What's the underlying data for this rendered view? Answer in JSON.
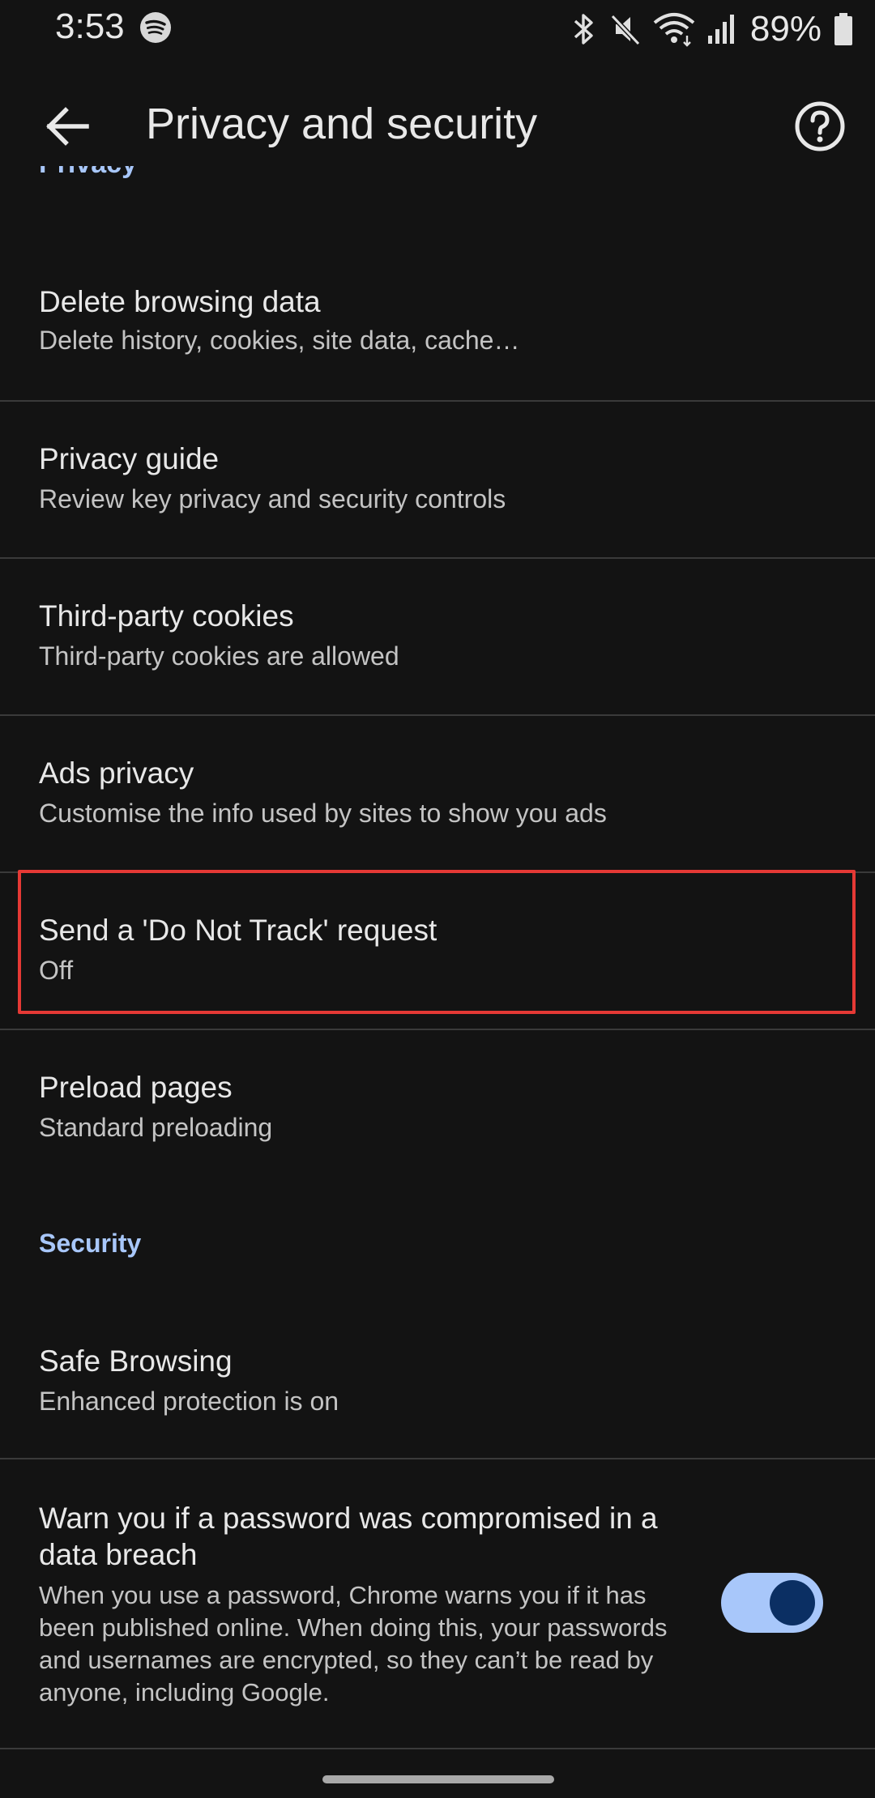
{
  "status_bar": {
    "time": "3:53",
    "battery": "89%",
    "icons": [
      "spotify-icon",
      "bluetooth-icon",
      "mute-icon",
      "wifi-icon",
      "signal-icon",
      "battery-icon"
    ]
  },
  "app_bar": {
    "title": "Privacy and security",
    "icons": [
      "back-arrow-icon",
      "help-icon"
    ]
  },
  "sections": {
    "privacy_header": "Privacy",
    "security_header": "Security"
  },
  "items": [
    {
      "title": "Delete browsing data",
      "subtitle": "Delete history, cookies, site data, cache…"
    },
    {
      "title": "Privacy guide",
      "subtitle": "Review key privacy and security controls"
    },
    {
      "title": "Third-party cookies",
      "subtitle": "Third-party cookies are allowed"
    },
    {
      "title": "Ads privacy",
      "subtitle": "Customise the info used by sites to show you ads"
    },
    {
      "title": "Send a 'Do Not Track' request",
      "subtitle": "Off"
    },
    {
      "title": "Preload pages",
      "subtitle": "Standard preloading"
    },
    {
      "title": "Safe Browsing",
      "subtitle": "Enhanced protection is on"
    }
  ],
  "password_warning": {
    "title": "Warn you if a password was compromised in a data breach",
    "description": "When you use a password, Chrome warns you if it has been published online. When doing this, your passwords and usernames are encrypted, so they can’t be read by anyone, including Google.",
    "enabled": true
  },
  "colors": {
    "background": "#131313",
    "accent": "#a8c7fa",
    "highlight": "#e53935"
  }
}
